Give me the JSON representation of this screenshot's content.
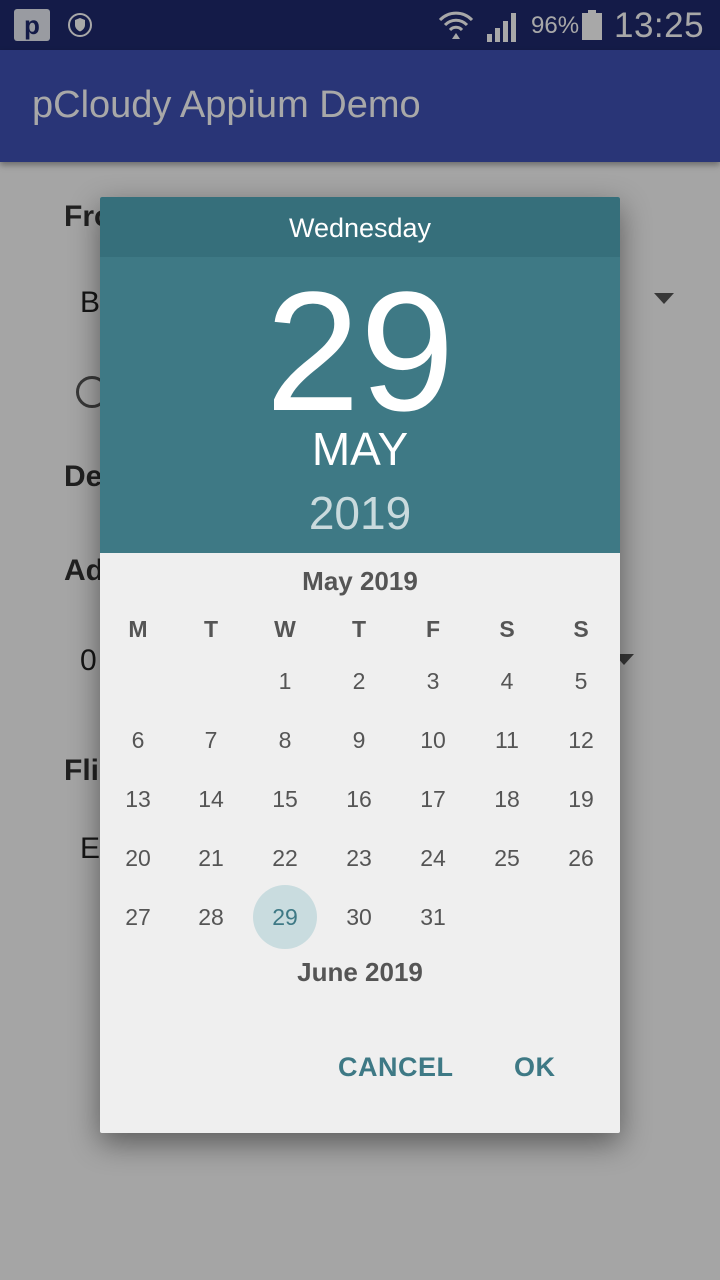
{
  "status_bar": {
    "app_icon_letter": "p",
    "battery": "96%",
    "time": "13:25"
  },
  "toolbar": {
    "title": "pCloudy Appium Demo"
  },
  "background": {
    "from_label": "Fro",
    "from_value": "B",
    "dep_label": "De",
    "adults_label": "Ad",
    "adults_value": "0",
    "flight_label": "Fli",
    "flight_value": "E"
  },
  "date_picker": {
    "weekday": "Wednesday",
    "day": "29",
    "month": "MAY",
    "year": "2019",
    "weekday_headers": [
      "M",
      "T",
      "W",
      "T",
      "F",
      "S",
      "S"
    ],
    "current_month_title": "May 2019",
    "selected_day": 29,
    "next_month_title": "June 2019",
    "cancel_label": "CANCEL",
    "ok_label": "OK",
    "accent_color": "#3e7985"
  }
}
